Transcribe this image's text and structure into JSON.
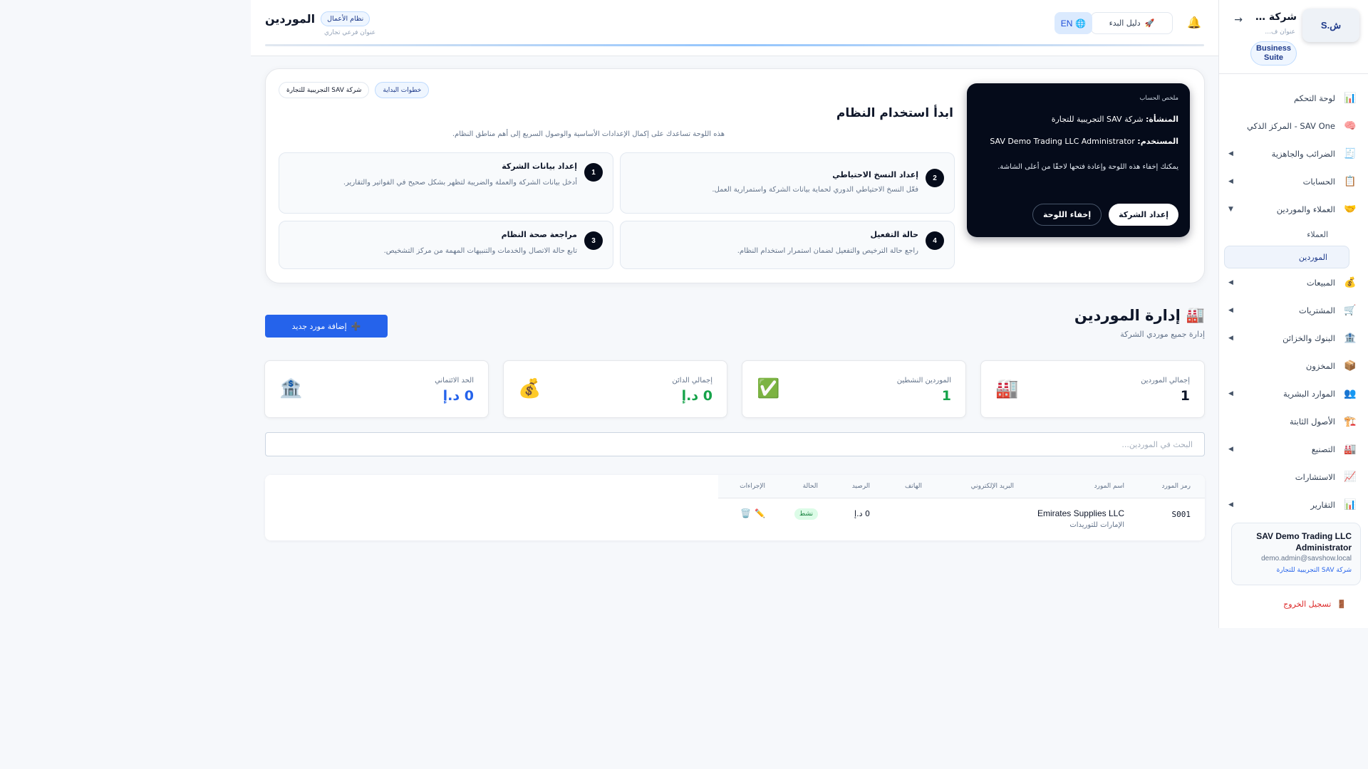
{
  "sidebar": {
    "logo_text": "ش.S",
    "company": "شركة …",
    "company_sub": "عنوان ف...",
    "collapse_arrow": "→",
    "suite_badge_line1": "Business",
    "suite_badge_line2": "Suite",
    "items": [
      {
        "label": "لوحة التحكم",
        "icon": "📊",
        "caret": ""
      },
      {
        "label": "SAV One - المركز الذكي",
        "icon": "🧠",
        "caret": ""
      },
      {
        "label": "الضرائب والجاهزية",
        "icon": "🧾",
        "caret": "◀"
      },
      {
        "label": "الحسابات",
        "icon": "📋",
        "caret": "◀"
      },
      {
        "label": "العملاء والموردين",
        "icon": "🤝",
        "caret": "▼"
      }
    ],
    "sub_items": [
      {
        "label": "العملاء"
      },
      {
        "label": "الموردين"
      }
    ],
    "items_after": [
      {
        "label": "المبيعات",
        "icon": "💰",
        "caret": "◀"
      },
      {
        "label": "المشتريات",
        "icon": "🛒",
        "caret": "◀"
      },
      {
        "label": "البنوك والخزائن",
        "icon": "🏦",
        "caret": "◀"
      },
      {
        "label": "المخزون",
        "icon": "📦",
        "caret": ""
      },
      {
        "label": "الموارد البشرية",
        "icon": "👥",
        "caret": "◀"
      },
      {
        "label": "الأصول الثابتة",
        "icon": "🏗️",
        "caret": ""
      },
      {
        "label": "التصنيع",
        "icon": "🏭",
        "caret": "◀"
      },
      {
        "label": "الاستشارات",
        "icon": "📈",
        "caret": ""
      },
      {
        "label": "التقارير",
        "icon": "📊",
        "caret": "◀"
      }
    ],
    "user": {
      "name": "SAV Demo Trading LLC Administrator",
      "email": "demo.admin@savshow.local",
      "org": "شركة SAV التجريبية للتجارة"
    },
    "logout": "تسجيل الخروج",
    "logout_icon": "🚪"
  },
  "topbar": {
    "title": "الموردين",
    "system_badge": "نظام الأعمال",
    "subtitle": "عنوان فرعي تجاري",
    "guide_label": "دليل البدء",
    "guide_icon": "🚀",
    "lang_label": "EN",
    "lang_icon": "🌐",
    "bell_icon": "🔔"
  },
  "getting_started": {
    "tag_steps": "خطوات البداية",
    "tag_company": "شركة SAV التجريبية للتجارة",
    "title": "ابدأ استخدام النظام",
    "description": "هذه اللوحة تساعدك على إكمال الإعدادات الأساسية والوصول السريع إلى أهم مناطق النظام.",
    "steps": [
      {
        "num": "1",
        "title": "إعداد بيانات الشركة",
        "desc": "أدخل بيانات الشركة والعملة والضريبة لتظهر بشكل صحيح في الفواتير والتقارير."
      },
      {
        "num": "2",
        "title": "إعداد النسخ الاحتياطي",
        "desc": "فعّل النسخ الاحتياطي الدوري لحماية بيانات الشركة واستمرارية العمل."
      },
      {
        "num": "3",
        "title": "مراجعة صحة النظام",
        "desc": "تابع حالة الاتصال والخدمات والتنبيهات المهمة من مركز التشخيص."
      },
      {
        "num": "4",
        "title": "حالة التفعيل",
        "desc": "راجع حالة الترخيص والتفعيل لضمان استمرار استخدام النظام."
      }
    ],
    "account": {
      "label": "ملخص الحساب",
      "org_key": "المنشأة:",
      "org_value": "شركة SAV التجريبية للتجارة",
      "user_key": "المستخدم:",
      "user_value": "SAV Demo Trading LLC Administrator",
      "note": "يمكنك إخفاء هذه اللوحة وإعادة فتحها لاحقًا من أعلى الشاشة.",
      "btn_setup": "إعداد الشركة",
      "btn_hide": "إخفاء اللوحة"
    }
  },
  "page": {
    "title": "إدارة الموردين",
    "title_icon": "🏭",
    "subtitle": "إدارة جميع موردي الشركة",
    "add_button": "إضافة مورد جديد",
    "add_icon": "➕"
  },
  "stats": [
    {
      "label": "إجمالي الموردين",
      "value": "1",
      "icon": "🏭",
      "color": "#0f172a"
    },
    {
      "label": "الموردين النشطين",
      "value": "1",
      "icon": "✅",
      "color": "#16a34a"
    },
    {
      "label": "إجمالي الدائن",
      "value": "0 د.إ",
      "icon": "💰",
      "color": "#16a34a"
    },
    {
      "label": "الحد الائتماني",
      "value": "0 د.إ",
      "icon": "🏦",
      "color": "#2563eb"
    }
  ],
  "search": {
    "placeholder": "البحث في الموردين..."
  },
  "table": {
    "headers": [
      "رمز المورد",
      "اسم المورد",
      "البريد الإلكتروني",
      "الهاتف",
      "الرصيد",
      "الحالة",
      "الإجراءات"
    ],
    "rows": [
      {
        "code": "S001",
        "name": "Emirates Supplies LLC",
        "name_sub": "الإمارات للتوريدات",
        "email": "",
        "phone": "",
        "balance": "0 د.إ",
        "status": "نشط",
        "edit_icon": "✏️",
        "delete_icon": "🗑️"
      }
    ]
  },
  "colors": {
    "accent": "#2563eb",
    "dark": "#050b1a",
    "success": "#16a34a",
    "danger": "#dc2626"
  }
}
